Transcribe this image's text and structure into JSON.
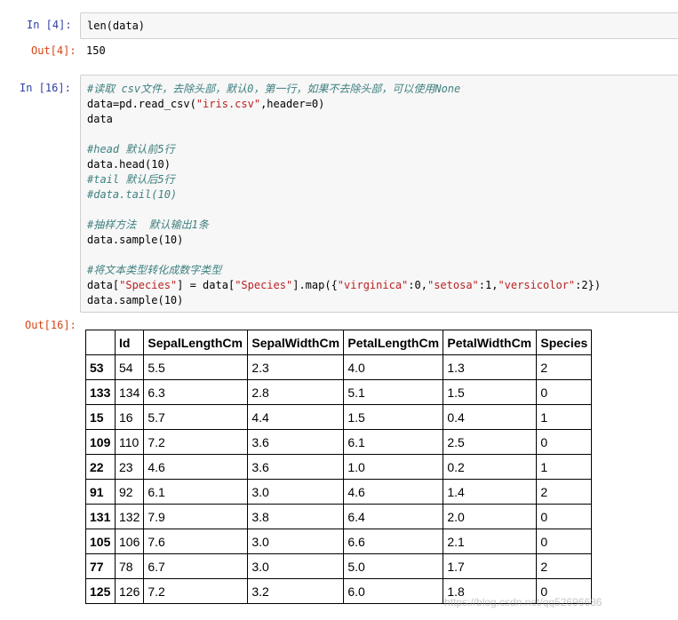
{
  "cell1": {
    "in_prompt": "In  [4]:",
    "code": "len(data)",
    "out_prompt": "Out[4]:",
    "output": "150"
  },
  "cell2": {
    "in_prompt": "In  [16]:",
    "out_prompt": "Out[16]:",
    "lines": [
      {
        "type": "comment",
        "text": "#读取 csv文件，去除头部，默认0，第一行，如果不去除头部，可以使用None"
      },
      {
        "type": "rich",
        "parts": [
          {
            "t": "data=pd.read_csv("
          },
          {
            "t": "\"iris.csv\"",
            "s": true
          },
          {
            "t": ",header=0)"
          }
        ]
      },
      {
        "type": "code",
        "text": "data"
      },
      {
        "type": "blank",
        "text": ""
      },
      {
        "type": "comment",
        "text": "#head 默认前5行"
      },
      {
        "type": "code",
        "text": "data.head(10)"
      },
      {
        "type": "comment",
        "text": "#tail 默认后5行"
      },
      {
        "type": "comment",
        "text": "#data.tail(10)"
      },
      {
        "type": "blank",
        "text": ""
      },
      {
        "type": "comment",
        "text": "#抽样方法  默认输出1条"
      },
      {
        "type": "code",
        "text": "data.sample(10)"
      },
      {
        "type": "blank",
        "text": ""
      },
      {
        "type": "comment",
        "text": "#将文本类型转化成数字类型"
      },
      {
        "type": "rich",
        "parts": [
          {
            "t": "data["
          },
          {
            "t": "\"Species\"",
            "s": true
          },
          {
            "t": "] = data["
          },
          {
            "t": "\"Species\"",
            "s": true
          },
          {
            "t": "].map({"
          },
          {
            "t": "\"virginica\"",
            "s": true
          },
          {
            "t": ":0,"
          },
          {
            "t": "\"setosa\"",
            "s": true
          },
          {
            "t": ":1,"
          },
          {
            "t": "\"versicolor\"",
            "s": true
          },
          {
            "t": ":2})"
          }
        ]
      },
      {
        "type": "code",
        "text": "data.sample(10)"
      }
    ]
  },
  "table": {
    "columns": [
      "",
      "Id",
      "SepalLengthCm",
      "SepalWidthCm",
      "PetalLengthCm",
      "PetalWidthCm",
      "Species"
    ],
    "rows": [
      {
        "index": "53",
        "cells": [
          "54",
          "5.5",
          "2.3",
          "4.0",
          "1.3",
          "2"
        ]
      },
      {
        "index": "133",
        "cells": [
          "134",
          "6.3",
          "2.8",
          "5.1",
          "1.5",
          "0"
        ]
      },
      {
        "index": "15",
        "cells": [
          "16",
          "5.7",
          "4.4",
          "1.5",
          "0.4",
          "1"
        ]
      },
      {
        "index": "109",
        "cells": [
          "110",
          "7.2",
          "3.6",
          "6.1",
          "2.5",
          "0"
        ]
      },
      {
        "index": "22",
        "cells": [
          "23",
          "4.6",
          "3.6",
          "1.0",
          "0.2",
          "1"
        ]
      },
      {
        "index": "91",
        "cells": [
          "92",
          "6.1",
          "3.0",
          "4.6",
          "1.4",
          "2"
        ]
      },
      {
        "index": "131",
        "cells": [
          "132",
          "7.9",
          "3.8",
          "6.4",
          "2.0",
          "0"
        ]
      },
      {
        "index": "105",
        "cells": [
          "106",
          "7.6",
          "3.0",
          "6.6",
          "2.1",
          "0"
        ]
      },
      {
        "index": "77",
        "cells": [
          "78",
          "6.7",
          "3.0",
          "5.0",
          "1.7",
          "2"
        ]
      },
      {
        "index": "125",
        "cells": [
          "126",
          "7.2",
          "3.2",
          "6.0",
          "1.8",
          "0"
        ]
      }
    ]
  },
  "watermark": "https://blog.csdn.net/qq52696686",
  "colors": {
    "in_prompt": "#303f9f",
    "out_prompt": "#d84315",
    "comment": "#408080",
    "string": "#ba2121",
    "input_bg": "#f7f7f7"
  }
}
